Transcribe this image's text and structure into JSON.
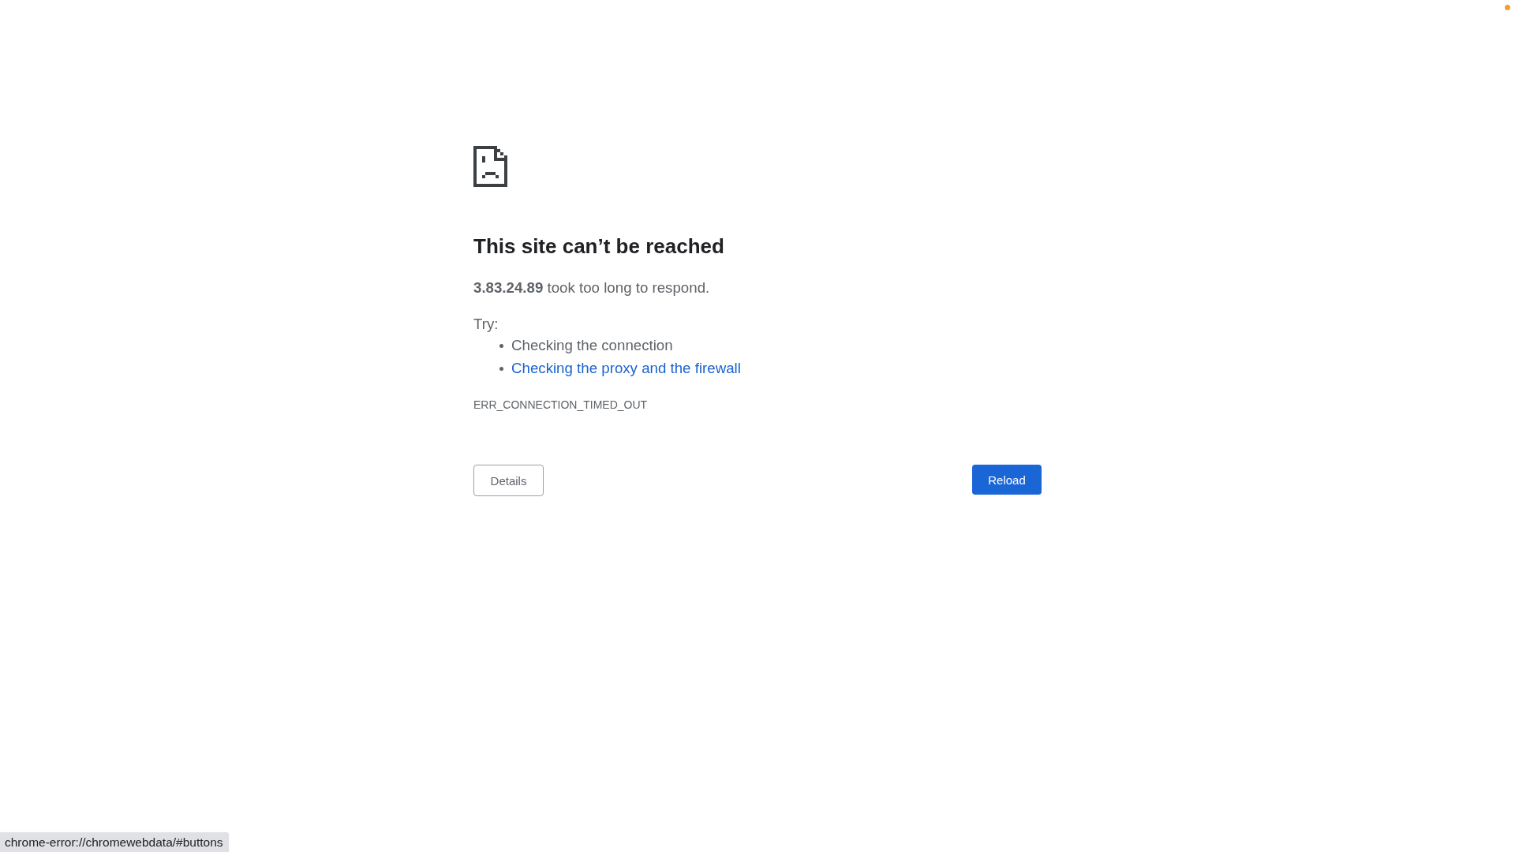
{
  "page": {
    "heading": "This site can’t be reached",
    "message": "**3.83.24.89** took too long to respond.",
    "suggestions_label": "Try:",
    "suggestions": [
      {
        "kind": "text",
        "text": "Checking the connection"
      },
      {
        "kind": "link",
        "text": "Checking the proxy and the firewall"
      }
    ],
    "error_code": "ERR_CONNECTION_TIMED_OUT",
    "buttons": [
      {
        "kind": "secondary",
        "label": "Details"
      },
      {
        "kind": "primary",
        "label": "Reload"
      }
    ]
  },
  "status_bar": {
    "url": "chrome-error://chromewebdata/#buttons"
  }
}
